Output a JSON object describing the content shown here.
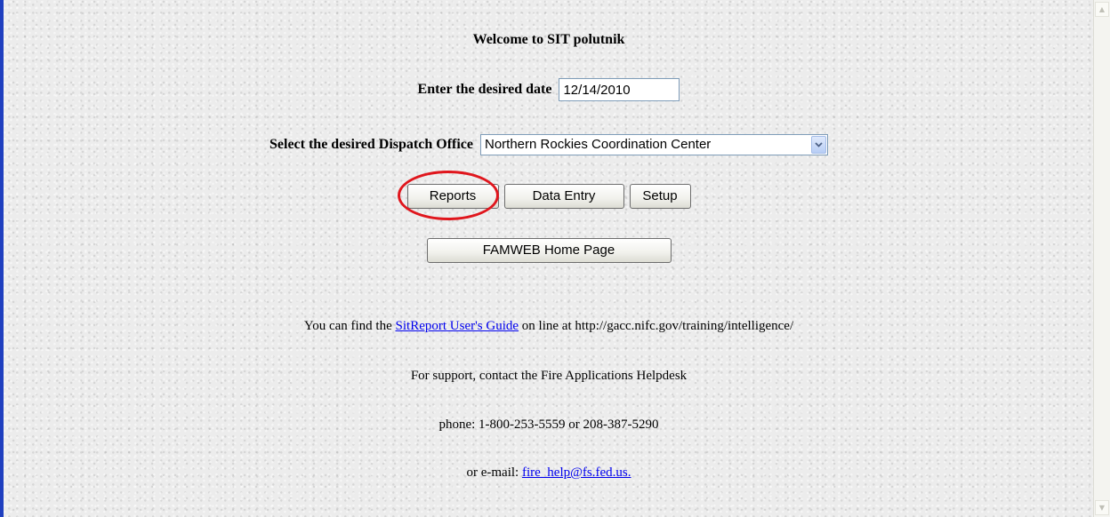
{
  "page": {
    "title": "Welcome to SIT polutnik",
    "date_label": "Enter the desired date",
    "date_value": "12/14/2010",
    "office_label": "Select the desired Dispatch Office",
    "office_selected": "Northern Rockies Coordination Center"
  },
  "buttons": {
    "reports": "Reports",
    "data_entry": "Data Entry",
    "setup": "Setup",
    "famweb_home": "FAMWEB Home Page"
  },
  "info": {
    "guide_prefix": "You can find the",
    "guide_link": "SitReport User's Guide",
    "guide_suffix": "on line at http://gacc.nifc.gov/training/intelligence/",
    "support_text": "For support, contact the Fire Applications Helpdesk",
    "phone_text": "phone: 1-800-253-5559 or 208-387-5290",
    "email_prefix": "or e-mail:",
    "email_link": "fire_help@fs.fed.us."
  },
  "colors": {
    "highlight_ring": "#e0161d",
    "link": "#0000ee",
    "left_edge": "#1f3fbf"
  },
  "icons": {
    "scroll_up": "scroll-up-arrow-icon",
    "scroll_down": "scroll-down-arrow-icon",
    "select_dropdown": "chevron-down-icon"
  }
}
